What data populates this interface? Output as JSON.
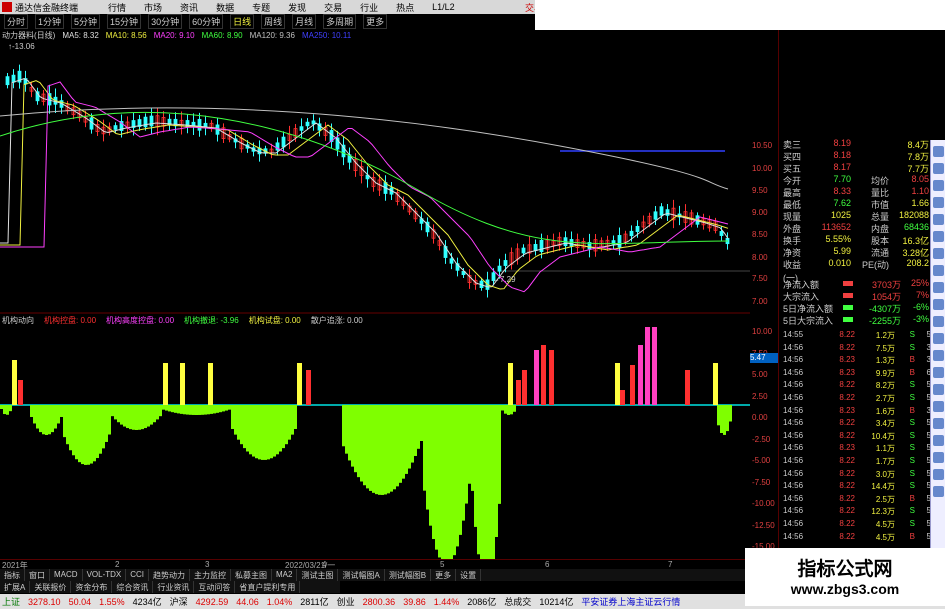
{
  "window": {
    "title": "通达信金融终端",
    "menus": [
      "行情",
      "市场",
      "资讯",
      "数据",
      "专题",
      "发现",
      "交易",
      "行业",
      "热点",
      "L1/L2"
    ],
    "right_label": "交易"
  },
  "toolbar": {
    "periods": [
      "分时",
      "1分钟",
      "5分钟",
      "15分钟",
      "30分钟",
      "60分钟",
      "日线",
      "周线",
      "月线",
      "多周期",
      "更多"
    ],
    "active": "日线"
  },
  "indicator_line": {
    "name": "动力器料(日线)",
    "items": [
      {
        "label": "MA5: 8.32",
        "color": "#e0e0e0"
      },
      {
        "label": "MA10: 8.56",
        "color": "#f0f040"
      },
      {
        "label": "MA20: 9.10",
        "color": "#ff40ff"
      },
      {
        "label": "MA60: 8.90",
        "color": "#40ff40"
      },
      {
        "label": "MA120: 9.36",
        "color": "#c0c0c0"
      },
      {
        "label": "MA250: 10.11",
        "color": "#4040ff"
      }
    ],
    "high_label": "13.06",
    "low_label": "7.29"
  },
  "sub_indicator": {
    "name": "机构动向",
    "items": [
      {
        "label": "机构控盘: 0.00",
        "color": "#ff3030"
      },
      {
        "label": "机构高度控盘: 0.00",
        "color": "#ff40ff"
      },
      {
        "label": "机构撤退: -3.96",
        "color": "#40ff40"
      },
      {
        "label": "机构试盘: 0.00",
        "color": "#f0f040"
      },
      {
        "label": "散户追涨: 0.00",
        "color": "#ccc"
      }
    ]
  },
  "scales": {
    "main": [
      "10.50",
      "10.00",
      "9.50",
      "9.00",
      "8.50",
      "8.00",
      "7.50",
      "7.00"
    ],
    "sub": [
      "10.00",
      "7.50",
      "5.00",
      "2.50",
      "0.00",
      "-2.50",
      "-5.00",
      "-7.50",
      "-10.00",
      "-12.50",
      "-15.00"
    ],
    "marker": "5.47"
  },
  "date_axis": [
    "2021年",
    "2",
    "3",
    "2022/03/21/一",
    "4",
    "5",
    "6",
    "7"
  ],
  "bottom_tabs": [
    "指标",
    "窗口",
    "MACD",
    "VOL-TDX",
    "CCI",
    "趋势动力",
    "主力监控",
    "私募主图",
    "MA2",
    "测试主图",
    "测试幅图A",
    "测试幅图B",
    "更多",
    "设置"
  ],
  "bottom_tabs2": [
    "扩展A",
    "关联报价",
    "资金分布",
    "综合资讯",
    "行业资讯",
    "互动问答",
    "省直户提利专用"
  ],
  "quote_panel": {
    "rows": [
      {
        "c1": "卖三",
        "c2": "8.19",
        "c3": "",
        "c4": "8.4万",
        "c2color": "#f04040",
        "c4color": "#f0f040"
      },
      {
        "c1": "买四",
        "c2": "8.18",
        "c3": "",
        "c4": "7.8万",
        "c2color": "#f04040",
        "c4color": "#f0f040"
      },
      {
        "c1": "买五",
        "c2": "8.17",
        "c3": "",
        "c4": "7.7万",
        "c2color": "#f04040",
        "c4color": "#f0f040"
      },
      {
        "c1": "今开",
        "c2": "7.70",
        "c3": "均价",
        "c4": "8.05",
        "c2color": "#40ff40",
        "c4color": "#f04040"
      },
      {
        "c1": "最高",
        "c2": "8.33",
        "c3": "量比",
        "c4": "1.10",
        "c2color": "#f04040",
        "c4color": "#f04040"
      },
      {
        "c1": "最低",
        "c2": "7.62",
        "c3": "市值",
        "c4": "1.66",
        "c2color": "#40ff40",
        "c4color": "#f0f040"
      },
      {
        "c1": "现量",
        "c2": "1025",
        "c3": "总量",
        "c4": "182088",
        "c2color": "#f0f040",
        "c4color": "#f0f040"
      },
      {
        "c1": "外盘",
        "c2": "113652",
        "c3": "内盘",
        "c4": "68436",
        "c2color": "#f04040",
        "c4color": "#40ff40"
      },
      {
        "c1": "换手",
        "c2": "5.55%",
        "c3": "股本",
        "c4": "16.3亿",
        "c2color": "#f0f040",
        "c4color": "#f0f040"
      },
      {
        "c1": "净资",
        "c2": "5.99",
        "c3": "流通",
        "c4": "3.28亿",
        "c2color": "#f0f040",
        "c4color": "#f0f040"
      },
      {
        "c1": "收益(一)",
        "c2": "0.010",
        "c3": "PE(动)",
        "c4": "208.2",
        "c2color": "#f0f040",
        "c4color": "#f0f040"
      }
    ],
    "flows": [
      {
        "label": "净流入额",
        "value": "3703万",
        "pct": "25%",
        "color": "#f04040"
      },
      {
        "label": "大宗流入",
        "value": "1054万",
        "pct": "7%",
        "color": "#f04040"
      },
      {
        "label": "5日净流入额",
        "value": "-4307万",
        "pct": "-6%",
        "color": "#40ff40"
      },
      {
        "label": "5日大宗流入",
        "value": "-2255万",
        "pct": "-3%",
        "color": "#40ff40"
      }
    ],
    "ticks": [
      {
        "t": "14:55",
        "p": "8.22",
        "v": "1.2万",
        "s": "S",
        "n": "5"
      },
      {
        "t": "14:56",
        "p": "8.22",
        "v": "7.5万",
        "s": "S",
        "n": "3"
      },
      {
        "t": "14:56",
        "p": "8.23",
        "v": "1.3万",
        "s": "B",
        "n": "3"
      },
      {
        "t": "14:56",
        "p": "8.23",
        "v": "9.9万",
        "s": "B",
        "n": "6"
      },
      {
        "t": "14:56",
        "p": "8.22",
        "v": "8.2万",
        "s": "S",
        "n": "5"
      },
      {
        "t": "14:56",
        "p": "8.22",
        "v": "2.7万",
        "s": "S",
        "n": "5"
      },
      {
        "t": "14:56",
        "p": "8.23",
        "v": "1.6万",
        "s": "B",
        "n": "3"
      },
      {
        "t": "14:56",
        "p": "8.22",
        "v": "3.4万",
        "s": "S",
        "n": "5"
      },
      {
        "t": "14:56",
        "p": "8.22",
        "v": "10.4万",
        "s": "S",
        "n": "5"
      },
      {
        "t": "14:56",
        "p": "8.23",
        "v": "1.1万",
        "s": "S",
        "n": "5"
      },
      {
        "t": "14:56",
        "p": "8.22",
        "v": "1.7万",
        "s": "S",
        "n": "5"
      },
      {
        "t": "14:56",
        "p": "8.22",
        "v": "3.0万",
        "s": "S",
        "n": "5"
      },
      {
        "t": "14:56",
        "p": "8.22",
        "v": "14.4万",
        "s": "S",
        "n": "5"
      },
      {
        "t": "14:56",
        "p": "8.22",
        "v": "2.5万",
        "s": "B",
        "n": "5"
      },
      {
        "t": "14:56",
        "p": "8.22",
        "v": "12.3万",
        "s": "S",
        "n": "5"
      },
      {
        "t": "14:56",
        "p": "8.22",
        "v": "4.5万",
        "s": "S",
        "n": "5"
      },
      {
        "t": "14:56",
        "p": "8.22",
        "v": "4.5万",
        "s": "B",
        "n": "5"
      }
    ]
  },
  "statusbar": {
    "items": [
      {
        "text": "上证",
        "color": "green"
      },
      {
        "text": "3278.10",
        "color": "red"
      },
      {
        "text": "50.04",
        "color": "red"
      },
      {
        "text": "1.55%",
        "color": "red"
      },
      {
        "text": "4234亿",
        "color": "black"
      },
      {
        "text": "沪深",
        "color": "black"
      },
      {
        "text": "4292.59",
        "color": "red"
      },
      {
        "text": "44.06",
        "color": "red"
      },
      {
        "text": "1.04%",
        "color": "red"
      },
      {
        "text": "2811亿",
        "color": "black"
      },
      {
        "text": "创业",
        "color": "black"
      },
      {
        "text": "2800.36",
        "color": "red"
      },
      {
        "text": "39.86",
        "color": "red"
      },
      {
        "text": "1.44%",
        "color": "red"
      },
      {
        "text": "2086亿",
        "color": "black"
      },
      {
        "text": "总成交",
        "color": "black"
      },
      {
        "text": "10214亿",
        "color": "black"
      },
      {
        "text": "平安证券上海主证云行情",
        "color": "blue"
      }
    ]
  },
  "watermark": {
    "line1": "指标公式网",
    "line2": "www.zbgs3.com"
  },
  "colors": {
    "up": "#ff3030",
    "down": "#30ffff",
    "ma5": "#e0e0e0",
    "ma10": "#f0f040",
    "ma20": "#ff40ff",
    "ma60": "#40ff40",
    "ma120": "#c0c0c0",
    "green_hist": "#7fff00",
    "yellow_bar": "#ffff40",
    "magenta_bar": "#ff40c0"
  }
}
